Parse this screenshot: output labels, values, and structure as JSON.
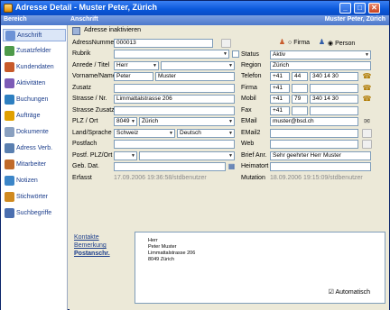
{
  "window": {
    "title": "Adresse Detail - Muster Peter, Zürich",
    "minimize": "_",
    "maximize": "□",
    "close": "✕"
  },
  "header": {
    "left": "Bereich",
    "section": "Anschrift",
    "contact": "Muster Peter, Zürich"
  },
  "sidebar": {
    "items": [
      {
        "label": "Anschrift",
        "icon": "envelope-icon",
        "color": "#6d93d6"
      },
      {
        "label": "Zusatzfelder",
        "icon": "fields-icon",
        "color": "#4e9a4a"
      },
      {
        "label": "Kundendaten",
        "icon": "customer-icon",
        "color": "#c85a2a"
      },
      {
        "label": "Aktivitäten",
        "icon": "activity-icon",
        "color": "#7c5bb7"
      },
      {
        "label": "Buchungen",
        "icon": "booking-icon",
        "color": "#2d7fc1"
      },
      {
        "label": "Aufträge",
        "icon": "order-icon",
        "color": "#e0a000"
      },
      {
        "label": "Dokumente",
        "icon": "document-icon",
        "color": "#8aa0c0"
      },
      {
        "label": "Adress Verb.",
        "icon": "link-icon",
        "color": "#5a7fb0"
      },
      {
        "label": "Mitarbeiter",
        "icon": "employee-icon",
        "color": "#c06a2a"
      },
      {
        "label": "Notizen",
        "icon": "notes-icon",
        "color": "#3c86c8"
      },
      {
        "label": "Stichwörter",
        "icon": "keywords-icon",
        "color": "#d08a20"
      },
      {
        "label": "Suchbegriffe",
        "icon": "search-terms-icon",
        "color": "#4b6fb0"
      }
    ]
  },
  "toolbar": {
    "deactivate": "Adresse inaktivieren"
  },
  "left_fields": {
    "adressnummer": {
      "label": "AdressNummer",
      "value": "000013"
    },
    "rubrik": {
      "label": "Rubrik",
      "value": ""
    },
    "anrede": {
      "label": "Anrede / Titel",
      "value": "Herr",
      "titel": ""
    },
    "name": {
      "label": "Vorname/Name",
      "vorname": "Peter",
      "nachname": "Muster"
    },
    "zusatz": {
      "label": "Zusatz",
      "value": ""
    },
    "strasse": {
      "label": "Strasse / Nr.",
      "value": "Limmattalstrasse 206"
    },
    "strasse_zusatz": {
      "label": "Strasse Zusatz",
      "value": ""
    },
    "plz": {
      "label": "PLZ / Ort",
      "plz": "8049",
      "ort": "Zürich"
    },
    "land": {
      "label": "Land/Sprache",
      "land": "Schweiz",
      "sprache": "Deutsch"
    },
    "postfach": {
      "label": "Postfach",
      "value": ""
    },
    "postf_plz": {
      "label": "Postf. PLZ/Ort",
      "value": ""
    },
    "geb": {
      "label": "Geb. Dat.",
      "value": ""
    },
    "erfasst": {
      "label": "Erfasst",
      "value": "17.09.2006 19:36:58/stdbenutzer"
    }
  },
  "right_fields": {
    "firma_radio": "Firma",
    "person_radio": "Person",
    "status": {
      "label": "Status",
      "value": "Aktiv"
    },
    "region": {
      "label": "Region",
      "value": "Zürich"
    },
    "telefon": {
      "label": "Telefon",
      "cc": "+41",
      "area": "44",
      "number": "340 14 30"
    },
    "firma": {
      "label": "Firma",
      "cc": "+41"
    },
    "mobil": {
      "label": "Mobil",
      "cc": "+41",
      "area": "79",
      "number": "340 14 30"
    },
    "fax": {
      "label": "Fax",
      "cc": "+41"
    },
    "email": {
      "label": "EMail",
      "value": "muster@bsd.ch"
    },
    "email2": {
      "label": "EMail2",
      "value": ""
    },
    "web": {
      "label": "Web",
      "value": ""
    },
    "brief": {
      "label": "Brief Anr.",
      "value": "Sehr geehrter Herr Muster"
    },
    "heimatort": {
      "label": "Heimatort",
      "value": ""
    },
    "mutation": {
      "label": "Mutation",
      "value": "18.09.2006 19:15:09/stdbenutzer"
    }
  },
  "bottom": {
    "links": [
      "Kontakte",
      "Bemerkung",
      "Postanschr."
    ],
    "address": [
      "Herr",
      "Peter Muster",
      "Limmattalstrasse 206",
      "8049 Zürich"
    ],
    "automatisch": "Automatisch"
  }
}
